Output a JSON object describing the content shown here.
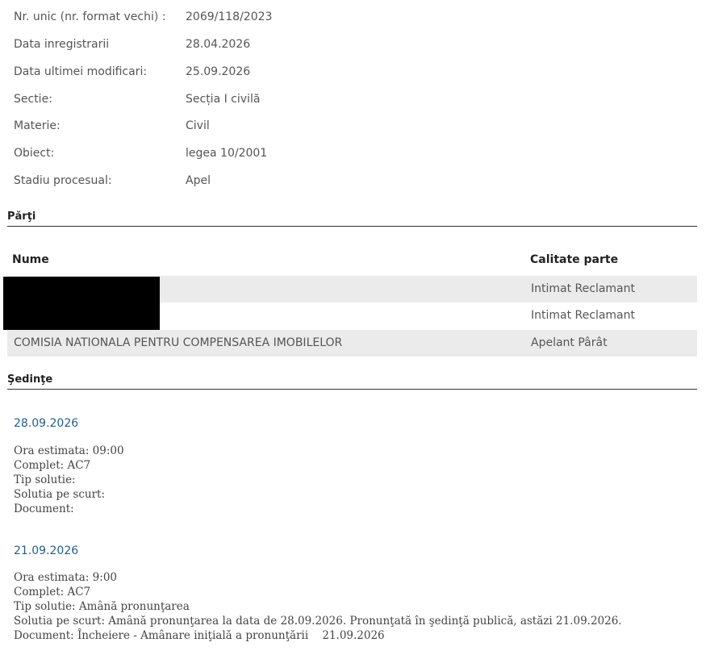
{
  "info": [
    {
      "label": "Nr. unic (nr. format vechi) :",
      "value": "2069/118/2023"
    },
    {
      "label": "Data inregistrarii",
      "value": "28.04.2026"
    },
    {
      "label": "Data ultimei modificari:",
      "value": "25.09.2026"
    },
    {
      "label": "Sectie:",
      "value": "Secția I civilă"
    },
    {
      "label": "Materie:",
      "value": "Civil"
    },
    {
      "label": "Obiect:",
      "value": "legea 10/2001"
    },
    {
      "label": "Stadiu procesual:",
      "value": "Apel"
    }
  ],
  "parti": {
    "title": "Părţi",
    "col_name": "Nume",
    "col_role": "Calitate parte",
    "rows": [
      {
        "name": "",
        "role": "Intimat Reclamant"
      },
      {
        "name": "",
        "role": "Intimat Reclamant"
      },
      {
        "name": "COMISIA NATIONALA PENTRU COMPENSAREA IMOBILELOR",
        "role": "Apelant Pârât"
      }
    ]
  },
  "sedinte": {
    "title": "Şedinţe",
    "items": [
      {
        "date": "28.09.2026",
        "ora": "Ora estimata: 09:00",
        "complet": "Complet: AC7",
        "tip": "Tip solutie:",
        "solutia": "Solutia pe scurt:",
        "document": "Document:"
      },
      {
        "date": "21.09.2026",
        "ora": "Ora estimata: 9:00",
        "complet": "Complet: AC7",
        "tip": "Tip solutie: Amână pronunţarea",
        "solutia": "Solutia pe scurt: Amână pronunţarea la data de 28.09.2026. Pronunţată în şedinţă publică, astăzi 21.09.2026.",
        "document": "Document: Încheiere - Amânare iniţială a pronunţării    21.09.2026"
      }
    ]
  },
  "colors": {
    "date_link": "#1f5f8b",
    "row_shade": "#ebebeb",
    "redaction": "#000000"
  }
}
